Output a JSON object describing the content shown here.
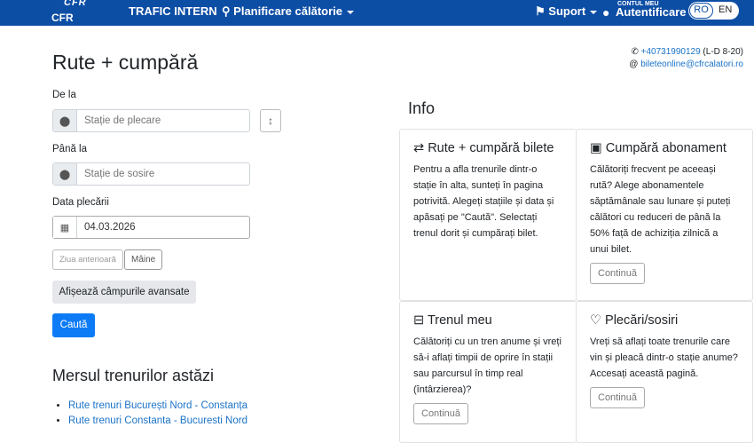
{
  "nav": {
    "logo_top": "CFR",
    "logo_bottom": "CFR Călători",
    "trafic": "TRAFIC INTERN",
    "planificare": "Planificare călătorie",
    "suport": "Suport",
    "cont_small": "CONTUL MEU",
    "autentificare": "Autentificare",
    "lang_ro": "RO",
    "lang_en": "EN"
  },
  "contact": {
    "phone": "+40731990129",
    "hours": "(L-D 8-20)",
    "email": "bileteonline@cfrcalatori.ro"
  },
  "form": {
    "title": "Rute + cumpără",
    "from_label": "De la",
    "from_placeholder": "Stație de plecare",
    "to_label": "Până la",
    "to_placeholder": "Stație de sosire",
    "date_label": "Data plecării",
    "date_value": "04.03.2026",
    "prev_day": "Ziua anterioară",
    "tomorrow": "Mâine",
    "advanced": "Afișează câmpurile avansate",
    "search": "Caută"
  },
  "today": {
    "title": "Mersul trenurilor astăzi",
    "links": [
      "Rute trenuri București Nord - Constanța",
      "Rute trenuri Constanta - Bucuresti Nord"
    ]
  },
  "info": {
    "title": "Info",
    "cards": [
      {
        "title": "Rute + cumpără bilete",
        "text": "Pentru a afla trenurile dintr-o stație în alta, sunteți în pagina potrivită. Alegeți stațiile și data și apăsați pe \"Caută\". Selectați trenul dorit și cumpărați bilet."
      },
      {
        "title": "Cumpără abonament",
        "text": "Călătoriți frecvent pe aceeași rută? Alege abonamentele săptămânale sau lunare și puteți călători cu reduceri de până la 50% față de achiziția zilnică a unui bilet.",
        "button": "Continuă"
      },
      {
        "title": "Trenul meu",
        "text": "Călătoriți cu un tren anume și vreți să-i aflați timpii de oprire în stații sau parcursul în timp real (întârzierea)?",
        "button": "Continuă"
      },
      {
        "title": "Plecări/sosiri",
        "text": "Vreți să aflați toate trenurile care vin și pleacă dintr-o stație anume? Accesați această pagină.",
        "button": "Continuă"
      }
    ]
  }
}
